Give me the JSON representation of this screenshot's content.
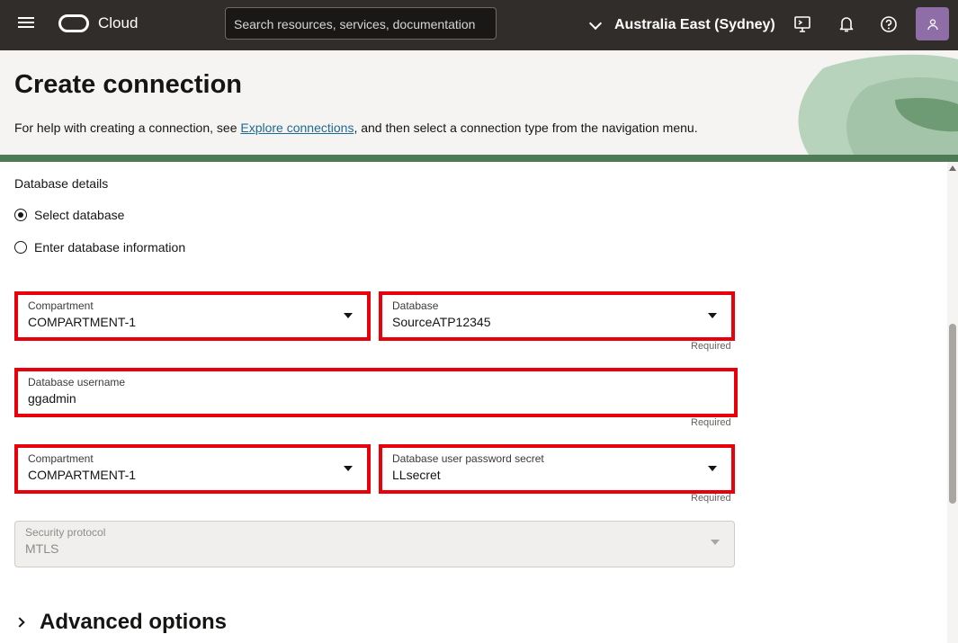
{
  "topbar": {
    "brand": "Cloud",
    "search_placeholder": "Search resources, services, documentation",
    "region": "Australia East (Sydney)"
  },
  "header": {
    "title": "Create connection",
    "help_prefix": "For help with creating a connection, see ",
    "help_link": "Explore connections",
    "help_suffix": ", and then select a connection type from the navigation menu."
  },
  "form": {
    "section_label": "Database details",
    "radio_options": [
      {
        "label": "Select database",
        "checked": true
      },
      {
        "label": "Enter database information",
        "checked": false
      }
    ],
    "compartment_1": {
      "label": "Compartment",
      "value": "COMPARTMENT-1"
    },
    "database": {
      "label": "Database",
      "value": "SourceATP12345",
      "hint": "Required"
    },
    "username": {
      "label": "Database username",
      "value": "ggadmin",
      "hint": "Required"
    },
    "compartment_2": {
      "label": "Compartment",
      "value": "COMPARTMENT-1"
    },
    "password_secret": {
      "label": "Database user password secret",
      "value": "LLsecret",
      "hint": "Required"
    },
    "security_protocol": {
      "label": "Security protocol",
      "value": "MTLS"
    },
    "advanced_options": "Advanced options"
  },
  "colors": {
    "topbar_bg": "#312d2a",
    "highlight": "#e8000b",
    "link": "#1f6b8f",
    "avatar_bg": "#8f6ea8"
  },
  "icons": {
    "menu": "hamburger-icon",
    "logo": "cloud-logo",
    "region": "chevron-down-icon",
    "cloud_shell": "cloud-shell-icon",
    "notifications": "bell-icon",
    "help": "help-icon",
    "profile": "user-icon"
  }
}
